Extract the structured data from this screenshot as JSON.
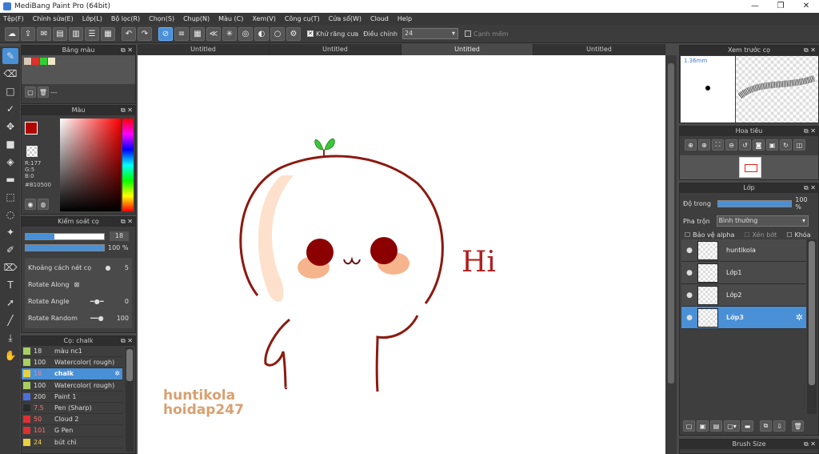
{
  "window": {
    "title": "MediBang Paint Pro (64bit)",
    "min": "—",
    "max": "❐",
    "close": "✕"
  },
  "menu": [
    "Tệp(F)",
    "Chỉnh sửa(E)",
    "Lớp(L)",
    "Bộ lọc(R)",
    "Chọn(S)",
    "Chụp(N)",
    "Màu (C)",
    "Xem(V)",
    "Công cụ(T)",
    "Cửa sổ(W)",
    "Cloud",
    "Help"
  ],
  "toolbar": {
    "antialias_label": "Khử răng cưa",
    "adjust_label": "Điều chỉnh",
    "adjust_value": "24",
    "sharp_edges_label": "Cạnh mềm"
  },
  "tabs": [
    "Untitled",
    "Untitled",
    "Untitled",
    "Untitled"
  ],
  "palette": {
    "title": "Bảng màu",
    "colors": [
      "#d9c9b6",
      "#e03030",
      "#30d030",
      "#f0e8c8"
    ],
    "dash": "---"
  },
  "color": {
    "title": "Màu",
    "r": "R:177",
    "g": "G:5",
    "b": "B:0",
    "hex": "#B10500",
    "main": "#b10500"
  },
  "brush_control": {
    "title": "Kiểm soát cọ",
    "size": "18",
    "opacity": "100 %",
    "stroke_spacing_label": "Khoảng cách nét cọ",
    "stroke_spacing_value": "5",
    "rotate_along_label": "Rotate Along",
    "rotate_angle_label": "Rotate Angle",
    "rotate_angle_value": "0",
    "rotate_random_label": "Rotate Random",
    "rotate_random_value": "100"
  },
  "brushes": {
    "title": "Cọ: chalk",
    "items": [
      {
        "size": "18",
        "name": "màu nc1",
        "color": "#a8d060"
      },
      {
        "size": "100",
        "name": "Watercolor( rough)",
        "color": "#a8d060"
      },
      {
        "size": "18",
        "name": "chalk",
        "color": "#e8d040"
      },
      {
        "size": "100",
        "name": "Watercolor( rough)",
        "color": "#a8d060"
      },
      {
        "size": "200",
        "name": "Paint 1",
        "color": "#4a70e0"
      },
      {
        "size": "7.5",
        "name": "Pen (Sharp)",
        "color": "#2a2a2a"
      },
      {
        "size": "50",
        "name": "Cloud 2",
        "color": "#e03030"
      },
      {
        "size": "101",
        "name": "G Pen",
        "color": "#e03030"
      },
      {
        "size": "24",
        "name": "bút chì",
        "color": "#e8d040"
      }
    ]
  },
  "canvas": {
    "hi_text": "Hi",
    "wm1": "huntikola",
    "wm2": "hoidap247"
  },
  "preview": {
    "title": "Xem trước cọ",
    "size_label": "1.36mm"
  },
  "navigator": {
    "title": "Hoa tiêu"
  },
  "layers": {
    "title": "Lớp",
    "opacity_label": "Độ trong",
    "opacity_value": "100 %",
    "blend_label": "Pha trộn",
    "blend_value": "Bình thường",
    "protect_alpha": "Bảo vệ alpha",
    "clipping": "Xén bớt",
    "lock": "Khóa",
    "items": [
      "huntikola",
      "Lớp1",
      "Lớp2",
      "Lớp3"
    ]
  },
  "brush_size_panel": {
    "title": "Brush Size"
  }
}
